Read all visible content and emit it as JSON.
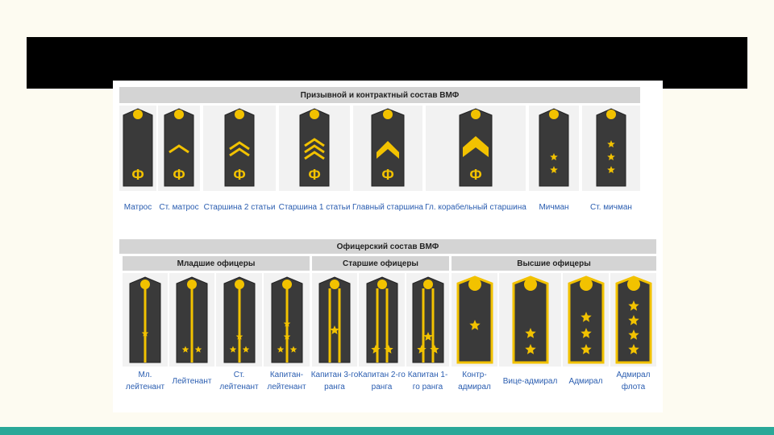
{
  "section1": {
    "title": "Призывной и контрактный состав ВМФ",
    "ranks": [
      {
        "label": "Матрос",
        "insignia": "plain-anchor-letter"
      },
      {
        "label": "Ст. матрос",
        "insignia": "one-chevron"
      },
      {
        "label": "Старшина 2 статьи",
        "insignia": "two-chevrons"
      },
      {
        "label": "Старшина 1 статьи",
        "insignia": "three-chevrons"
      },
      {
        "label": "Главный старшина",
        "insignia": "wide-chevron"
      },
      {
        "label": "Гл. корабельный старшина",
        "insignia": "wide-chevron-bar"
      },
      {
        "label": "Мичман",
        "insignia": "two-stars"
      },
      {
        "label": "Ст. мичман",
        "insignia": "three-stars"
      }
    ],
    "emblem_letter": "Ф"
  },
  "section2": {
    "title": "Офицерский состав ВМФ",
    "groups": [
      "Младшие офицеры",
      "Старшие офицеры",
      "Высшие офицеры"
    ],
    "ranks": [
      {
        "label": "Мл. лейтенант",
        "stars": 1
      },
      {
        "label": "Лейтенант",
        "stars": 2
      },
      {
        "label": "Ст. лейтенант",
        "stars": 3
      },
      {
        "label": "Капитан-лейтенант",
        "stars": 4
      },
      {
        "label": "Капитан 3-го ранга",
        "stars": 1
      },
      {
        "label": "Капитан 2-го ранга",
        "stars": 2
      },
      {
        "label": "Капитан 1-го ранга",
        "stars": 3
      },
      {
        "label": "Контр-адмирал",
        "stars": 1
      },
      {
        "label": "Вице-адмирал",
        "stars": 2
      },
      {
        "label": "Адмирал",
        "stars": 3
      },
      {
        "label": "Адмирал флота",
        "stars": 4
      }
    ]
  },
  "colors": {
    "gold": "#f2c200",
    "board": "#3a3a3a",
    "link": "#2a5db0",
    "header_bg": "#d4d4d4",
    "strip": "#2aa898"
  }
}
